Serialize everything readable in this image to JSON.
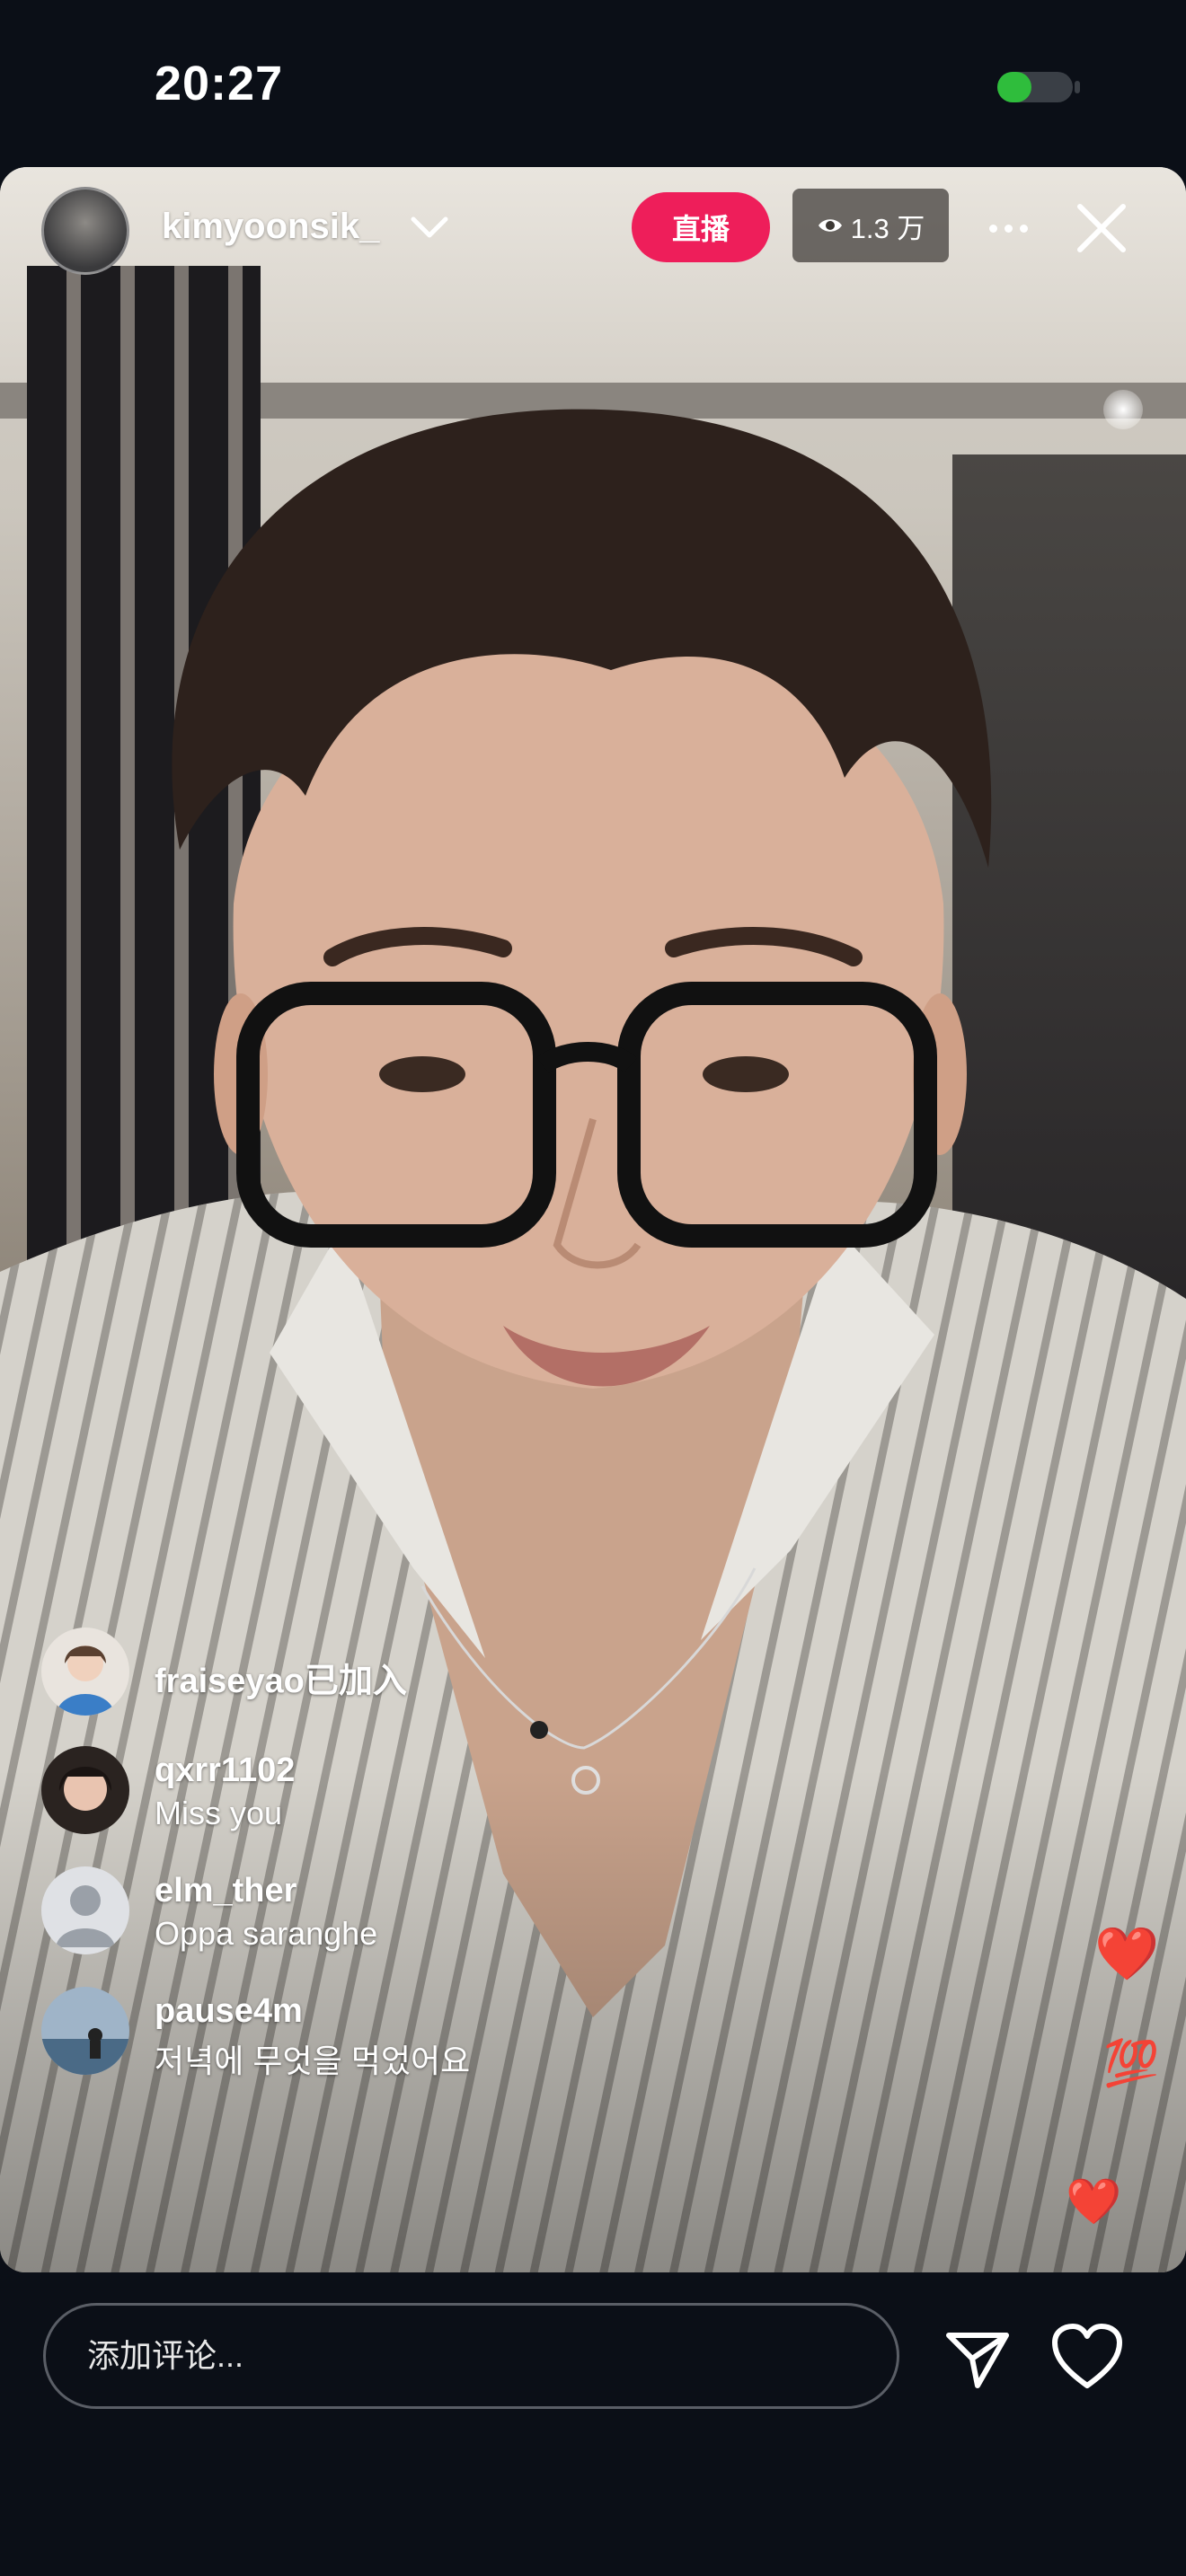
{
  "status_bar": {
    "time": "20:27",
    "battery_level": 0.45,
    "battery_color": "#2fbd3c"
  },
  "live": {
    "host_username": "kimyoonsik_",
    "live_badge": "直播",
    "live_badge_color": "#ee1e5a",
    "viewer_count": "1.3 万",
    "icons": [
      "chevron-down-icon",
      "eye-icon",
      "more-icon",
      "close-icon"
    ]
  },
  "comments": [
    {
      "username": "fraiseyao",
      "text": "已加入",
      "type": "joined"
    },
    {
      "username": "qxrr1102",
      "text": "Miss you",
      "type": "comment"
    },
    {
      "username": "elm_ther",
      "text": "Oppa saranghe",
      "type": "comment"
    },
    {
      "username": "pause4m",
      "text": "저녁에 무엇을 먹었어요",
      "type": "comment"
    }
  ],
  "reactions": [
    "❤️",
    "💯",
    "❤️"
  ],
  "bottom_bar": {
    "comment_placeholder": "添加评论...",
    "icons": [
      "send-icon",
      "heart-icon"
    ]
  }
}
